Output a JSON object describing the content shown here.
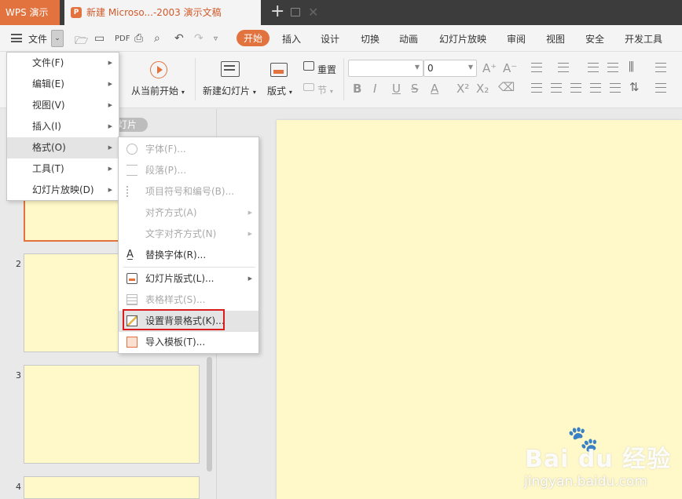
{
  "app": {
    "app_tab": "WPS 演示",
    "doc_tab_title": "新建 Microso...-2003 演示文稿",
    "doc_icon_letter": "P"
  },
  "menubar": {
    "file_label": "文件",
    "tabs": [
      {
        "label": "开始",
        "active": true
      },
      {
        "label": "插入"
      },
      {
        "label": "设计"
      },
      {
        "label": "切换"
      },
      {
        "label": "动画"
      },
      {
        "label": "幻灯片放映"
      },
      {
        "label": "审阅"
      },
      {
        "label": "视图"
      },
      {
        "label": "安全"
      },
      {
        "label": "开发工具"
      }
    ]
  },
  "toolbar": {
    "from_current": "从当前开始",
    "new_slide": "新建幻灯片",
    "layout": "版式",
    "reset": "重置",
    "section": "节",
    "font_size_value": "0"
  },
  "slide_panel": {
    "tab_label": "灯片",
    "slide_numbers": [
      "2",
      "3",
      "4"
    ]
  },
  "file_menu": {
    "items": [
      {
        "label": "文件(F)"
      },
      {
        "label": "编辑(E)"
      },
      {
        "label": "视图(V)"
      },
      {
        "label": "插入(I)"
      },
      {
        "label": "格式(O)",
        "hover": true
      },
      {
        "label": "工具(T)"
      },
      {
        "label": "幻灯片放映(D)"
      }
    ]
  },
  "format_menu": {
    "items": [
      {
        "label": "字体(F)...",
        "disabled": true
      },
      {
        "label": "段落(P)...",
        "disabled": true
      },
      {
        "label": "项目符号和编号(B)...",
        "disabled": true
      },
      {
        "label": "对齐方式(A)",
        "disabled": true
      },
      {
        "label": "文字对齐方式(N)",
        "disabled": true
      },
      {
        "label": "替换字体(R)..."
      },
      {
        "label": "幻灯片版式(L)..."
      },
      {
        "label": "表格样式(S)...",
        "disabled": true
      },
      {
        "label": "设置背景格式(K)...",
        "hover": true
      },
      {
        "label": "导入模板(T)..."
      }
    ]
  },
  "watermark": {
    "brand": "Bai du 经验",
    "url": "jingyan.baidu.com"
  },
  "colors": {
    "accent": "#e2733f",
    "slide_bg": "#fff9c9",
    "highlight": "#d91c1c"
  }
}
